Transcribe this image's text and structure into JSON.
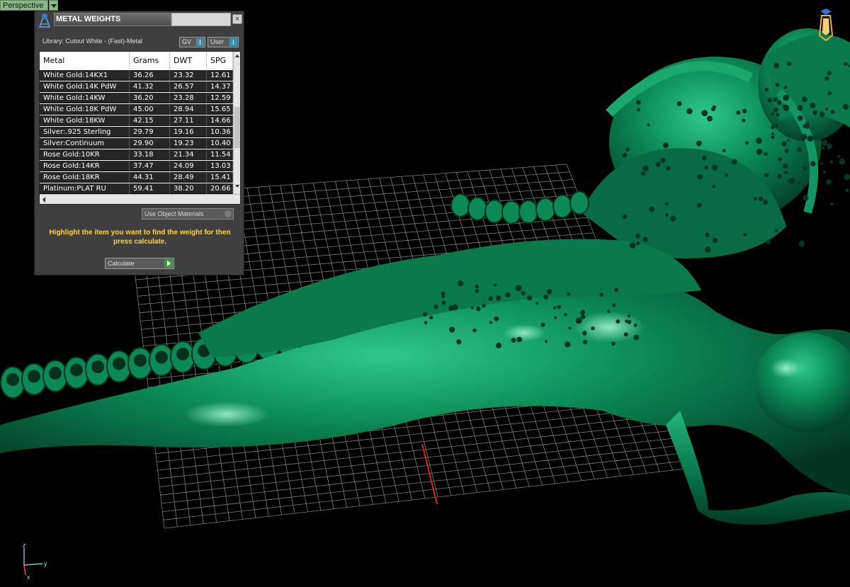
{
  "viewport": {
    "label": "Perspective",
    "axis": {
      "z": "z",
      "y": "y",
      "x": "x"
    }
  },
  "panel": {
    "title": "METAL WEIGHTS",
    "close_label": "×",
    "library": "Library: Cutout White - (Fast)-Metal",
    "gv_label": "GV",
    "user_label": "User",
    "columns": [
      "Metal",
      "Grams",
      "DWT",
      "SPG"
    ],
    "rows": [
      [
        "White Gold:14KX1",
        "36.26",
        "23.32",
        "12.61"
      ],
      [
        "White Gold:14K PdW",
        "41.32",
        "26.57",
        "14.37"
      ],
      [
        "White Gold:14KW",
        "36.20",
        "23.28",
        "12.59"
      ],
      [
        "White Gold:18K PdW",
        "45.00",
        "28.94",
        "15.65"
      ],
      [
        "White Gold:18KW",
        "42.15",
        "27.11",
        "14.66"
      ],
      [
        "Silver:.925 Sterling",
        "29.79",
        "19.16",
        "10.36"
      ],
      [
        "Silver:Continuum",
        "29.90",
        "19.23",
        "10.40"
      ],
      [
        "Rose Gold:10KR",
        "33.18",
        "21.34",
        "11.54"
      ],
      [
        "Rose Gold:14KR",
        "37.47",
        "24.09",
        "13.03"
      ],
      [
        "Rose Gold:18KR",
        "44.31",
        "28.49",
        "15.41"
      ],
      [
        "Platinum:PLAT RU",
        "59.41",
        "38.20",
        "20.66"
      ]
    ],
    "use_materials_label": "Use Object Materials",
    "hint": "Highlight the item you want to find the weight for then press calculate.",
    "calculate_label": "Calculate"
  },
  "colors": {
    "model": "#0b8a55",
    "grid": "#8a8a8a",
    "hint": "#ffd43a",
    "accent": "#3a90b8"
  }
}
